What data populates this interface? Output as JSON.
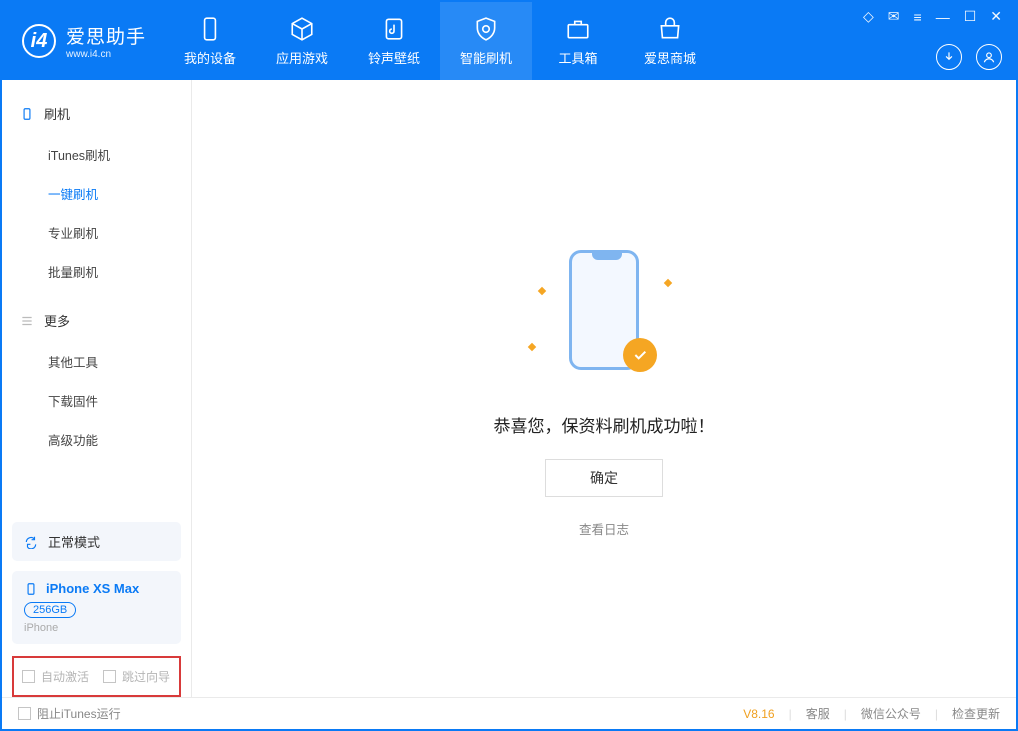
{
  "app": {
    "title": "爱思助手",
    "subtitle": "www.i4.cn"
  },
  "nav": {
    "items": [
      {
        "label": "我的设备"
      },
      {
        "label": "应用游戏"
      },
      {
        "label": "铃声壁纸"
      },
      {
        "label": "智能刷机"
      },
      {
        "label": "工具箱"
      },
      {
        "label": "爱思商城"
      }
    ],
    "active_index": 3
  },
  "sidebar": {
    "group1_title": "刷机",
    "group1_items": [
      {
        "label": "iTunes刷机"
      },
      {
        "label": "一键刷机"
      },
      {
        "label": "专业刷机"
      },
      {
        "label": "批量刷机"
      }
    ],
    "group1_active": 1,
    "group2_title": "更多",
    "group2_items": [
      {
        "label": "其他工具"
      },
      {
        "label": "下载固件"
      },
      {
        "label": "高级功能"
      }
    ],
    "mode_label": "正常模式",
    "device": {
      "name": "iPhone XS Max",
      "capacity": "256GB",
      "sub": "iPhone"
    },
    "checkbox_auto_activate": "自动激活",
    "checkbox_skip_guide": "跳过向导"
  },
  "main": {
    "success_message": "恭喜您，保资料刷机成功啦！",
    "ok_button": "确定",
    "view_log": "查看日志"
  },
  "footer": {
    "block_itunes": "阻止iTunes运行",
    "version": "V8.16",
    "support": "客服",
    "wechat": "微信公众号",
    "update": "检查更新"
  }
}
